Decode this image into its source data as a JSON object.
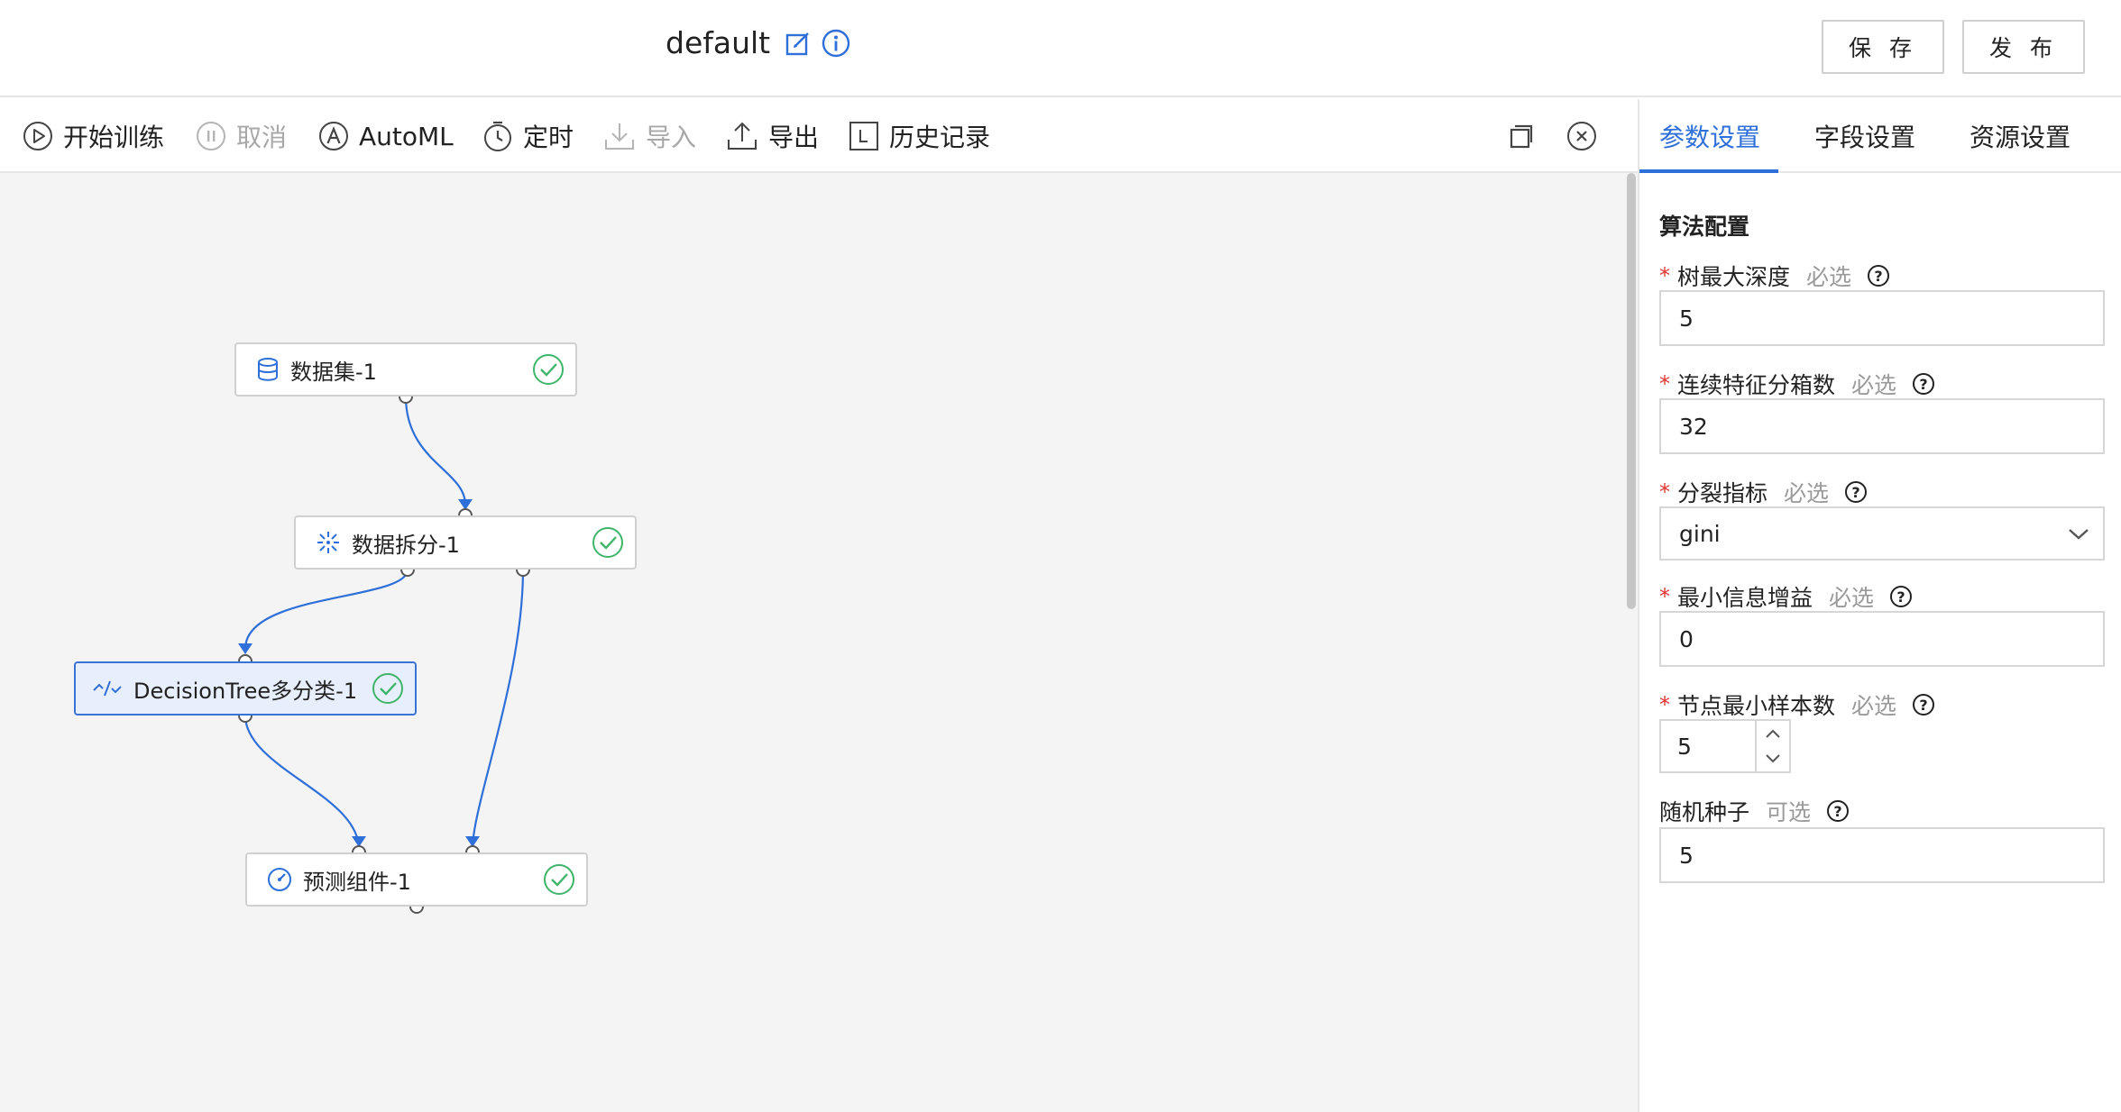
{
  "header": {
    "title": "default",
    "save_label": "保 存",
    "publish_label": "发 布"
  },
  "toolbar": {
    "items": [
      {
        "label": "开始训练",
        "icon": "play-circle-icon",
        "enabled": true
      },
      {
        "label": "取消",
        "icon": "pause-circle-icon",
        "enabled": false
      },
      {
        "label": "AutoML",
        "icon": "automl-circle-icon",
        "enabled": true
      },
      {
        "label": "定时",
        "icon": "timer-icon",
        "enabled": true
      },
      {
        "label": "导入",
        "icon": "import-icon",
        "enabled": false
      },
      {
        "label": "导出",
        "icon": "export-icon",
        "enabled": true
      },
      {
        "label": "历史记录",
        "icon": "history-icon",
        "enabled": true
      }
    ]
  },
  "canvas": {
    "nodes": [
      {
        "label": "数据集-1",
        "icon": "database-icon",
        "status": "success"
      },
      {
        "label": "数据拆分-1",
        "icon": "split-icon",
        "status": "success"
      },
      {
        "label": "DecisionTree多分类-1",
        "icon": "algorithm-icon",
        "status": "success",
        "selected": true
      },
      {
        "label": "预测组件-1",
        "icon": "predict-gauge-icon",
        "status": "success"
      }
    ]
  },
  "panel": {
    "tabs": [
      {
        "label": "参数设置",
        "active": true
      },
      {
        "label": "字段设置",
        "active": false
      },
      {
        "label": "资源设置",
        "active": false
      }
    ],
    "section_title": "算法配置",
    "fields": [
      {
        "label": "树最大深度",
        "hint": "必选",
        "required": true,
        "value": "5",
        "kind": "input"
      },
      {
        "label": "连续特征分箱数",
        "hint": "必选",
        "required": true,
        "value": "32",
        "kind": "input"
      },
      {
        "label": "分裂指标",
        "hint": "必选",
        "required": true,
        "value": "gini",
        "kind": "select"
      },
      {
        "label": "最小信息增益",
        "hint": "必选",
        "required": true,
        "value": "0",
        "kind": "input"
      },
      {
        "label": "节点最小样本数",
        "hint": "必选",
        "required": true,
        "value": "5",
        "kind": "stepper"
      },
      {
        "label": "随机种子",
        "hint": "可选",
        "required": false,
        "value": "5",
        "kind": "input"
      }
    ],
    "required_mark": "*",
    "help_glyph": "?"
  },
  "colors": {
    "accent": "#2e6fd9",
    "success": "#3fb56a",
    "required": "#e0322f",
    "canvas_bg": "#f4f4f4"
  }
}
